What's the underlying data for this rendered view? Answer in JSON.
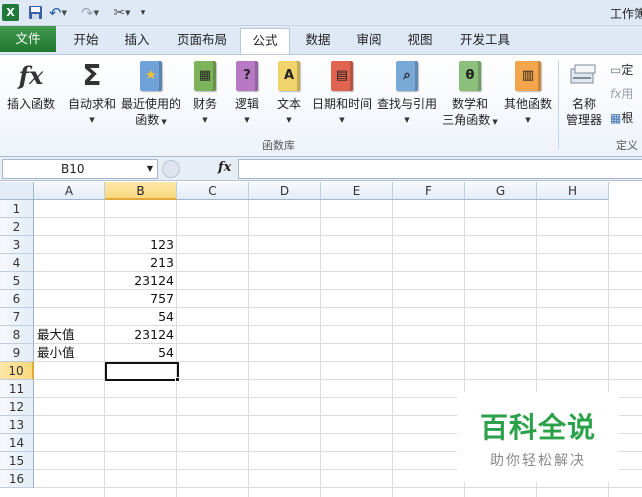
{
  "window": {
    "title": "工作簿"
  },
  "tabs": [
    "文件",
    "开始",
    "插入",
    "页面布局",
    "公式",
    "数据",
    "审阅",
    "视图",
    "开发工具"
  ],
  "active_tab": "公式",
  "ribbon": {
    "insert_function": "插入函数",
    "autosum": "自动求和",
    "recent_line1": "最近使用的",
    "recent_line2": "函数",
    "financial": "财务",
    "logical": "逻辑",
    "text": "文本",
    "datetime": "日期和时间",
    "lookup": "查找与引用",
    "math_line1": "数学和",
    "math_line2": "三角函数",
    "more": "其他函数",
    "name_mgr_line1": "名称",
    "name_mgr_line2": "管理器",
    "define_name": "定",
    "use_in_formula": "用",
    "create_from": "根",
    "group_library": "函数库",
    "group_defined": "定义"
  },
  "formula_bar": {
    "name_box": "B10",
    "fx": "fx",
    "value": ""
  },
  "columns": [
    "A",
    "B",
    "C",
    "D",
    "E",
    "F",
    "G",
    "H"
  ],
  "rows": [
    "1",
    "2",
    "3",
    "4",
    "5",
    "6",
    "7",
    "8",
    "9",
    "10",
    "11",
    "12",
    "13",
    "14",
    "15",
    "16"
  ],
  "selected": {
    "column": "B",
    "row": "10"
  },
  "cells": {
    "B3": "123",
    "B4": "213",
    "B5": "23124",
    "B6": "757",
    "B7": "54",
    "A8": "最大值",
    "B8": "23124",
    "A9": "最小值",
    "B9": "54"
  },
  "watermark": {
    "title": "百科全说",
    "subtitle": "助你轻松解决"
  },
  "colors": {
    "file_tab": "#21782f",
    "selection_header": "#f9d880",
    "watermark": "#2ba24a"
  }
}
